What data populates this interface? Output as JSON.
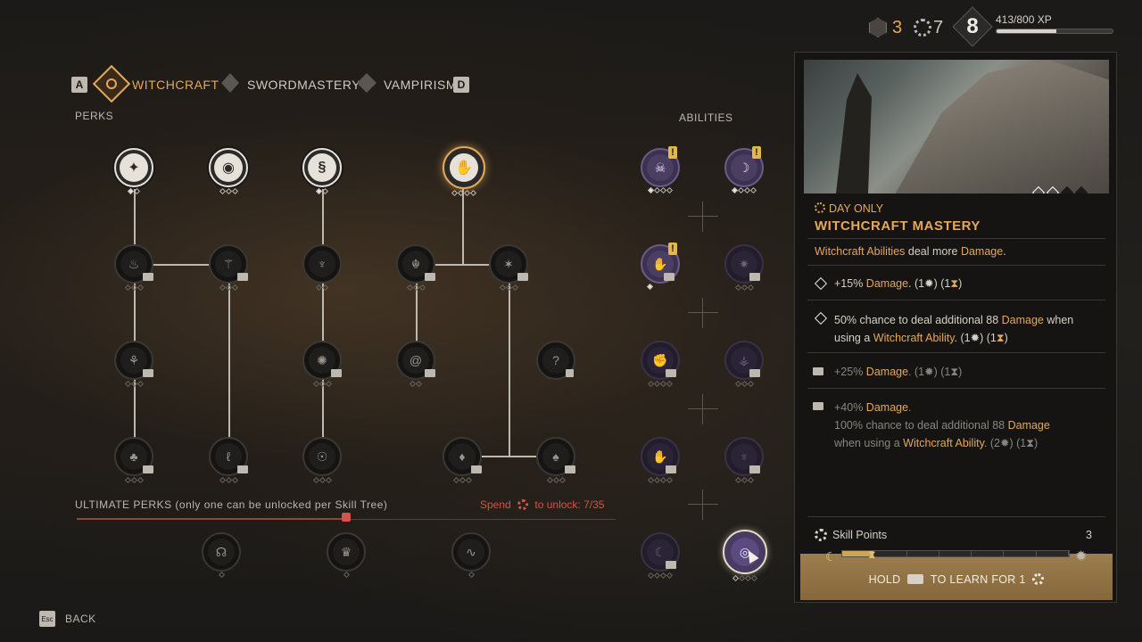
{
  "resources": {
    "shards": "3",
    "skill_points": "7",
    "level": "8",
    "xp_text": "413/800 XP",
    "xp_progress": 0.516
  },
  "tabs": {
    "prev_key": "A",
    "next_key": "D",
    "items": [
      {
        "label": "WITCHCRAFT",
        "active": true
      },
      {
        "label": "SWORDMASTERY",
        "active": false
      },
      {
        "label": "VAMPIRISM",
        "active": false
      }
    ]
  },
  "labels": {
    "perks": "PERKS",
    "abilities": "ABILITIES",
    "ultimate": "ULTIMATE PERKS (only one can be unlocked per Skill Tree)",
    "spend_prefix": "Spend",
    "spend_suffix": "to unlock: 7/35",
    "back_key": "Esc",
    "back": "BACK"
  },
  "detail": {
    "time_tag": "DAY ONLY",
    "title": "WITCHCRAFT MASTERY",
    "summary_pre": "Witchcraft Abilities",
    "summary_mid": " deal more ",
    "summary_hl": "Damage",
    "summary_end": ".",
    "tiers": [
      {
        "pre": "+15% ",
        "hl": "Damage",
        "post": ".",
        "cost": "(1",
        "cost2": ") (1",
        "cost3": ")"
      },
      {
        "pre": "50% chance to deal additional 88 ",
        "hl": "Damage",
        "post": " when",
        "line2_pre": "using a ",
        "line2_hl": "Witchcraft Ability",
        "cost": ". (1",
        "cost2": ") (1",
        "cost3": ")"
      },
      {
        "pre": "+25% ",
        "hl": "Damage",
        "post": ".",
        "cost": "(1",
        "cost2": ") (1",
        "cost3": ")"
      },
      {
        "pre": "+40% ",
        "hl": "Damage",
        "post": ".",
        "line2_pre": "100% chance to deal additional 88 ",
        "line2_hl": "Damage",
        "line3_pre": "when using a ",
        "line3_hl": "Witchcraft Ability",
        "cost": ". (2",
        "cost2": ") (1",
        "cost3": ")"
      }
    ],
    "skill_points_label": "Skill Points",
    "skill_points_value": "3",
    "hold_pre": "HOLD",
    "hold_mid": "TO LEARN FOR 1"
  },
  "colors": {
    "accent": "#e3a85a",
    "spend_red": "#d8514a",
    "ability_purple": "#4a3e62"
  }
}
